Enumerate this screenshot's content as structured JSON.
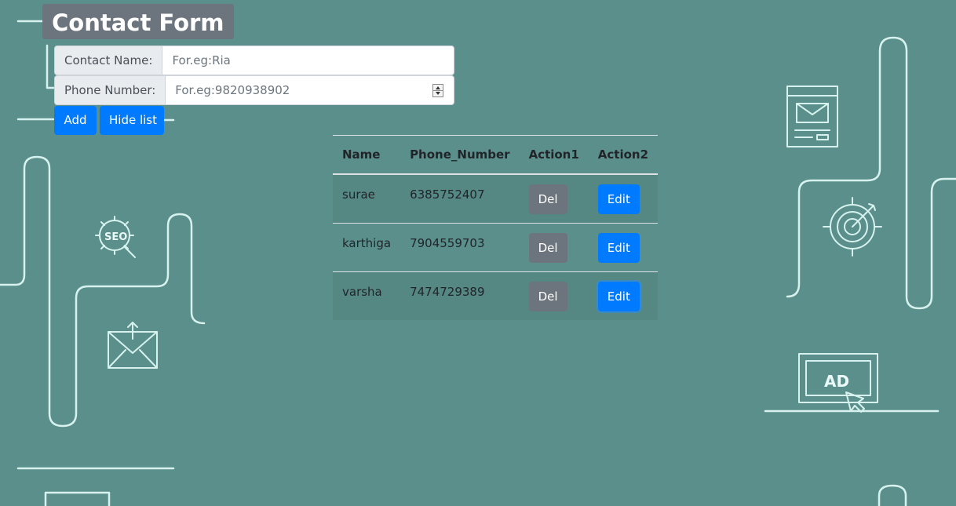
{
  "form": {
    "title": "Contact Form",
    "name_label": "Contact Name:",
    "name_placeholder": "For.eg:Ria",
    "phone_label": "Phone Number:",
    "phone_placeholder": "For.eg:9820938902",
    "add_label": "Add",
    "hide_label": "Hide list"
  },
  "table": {
    "headers": [
      "Name",
      "Phone_Number",
      "Action1",
      "Action2"
    ],
    "rows": [
      {
        "name": "surae",
        "phone": "6385752407",
        "del": "Del",
        "edit": "Edit"
      },
      {
        "name": "karthiga",
        "phone": "7904559703",
        "del": "Del",
        "edit": "Edit"
      },
      {
        "name": "varsha",
        "phone": "7474729389",
        "del": "Del",
        "edit": "Edit"
      }
    ]
  },
  "decor": {
    "seo_text": "SEO",
    "ad_text": "AD"
  },
  "colors": {
    "background": "#5a8f8b",
    "primary": "#007bff",
    "secondary": "#6c757d",
    "line_art": "#d7f2ee"
  }
}
